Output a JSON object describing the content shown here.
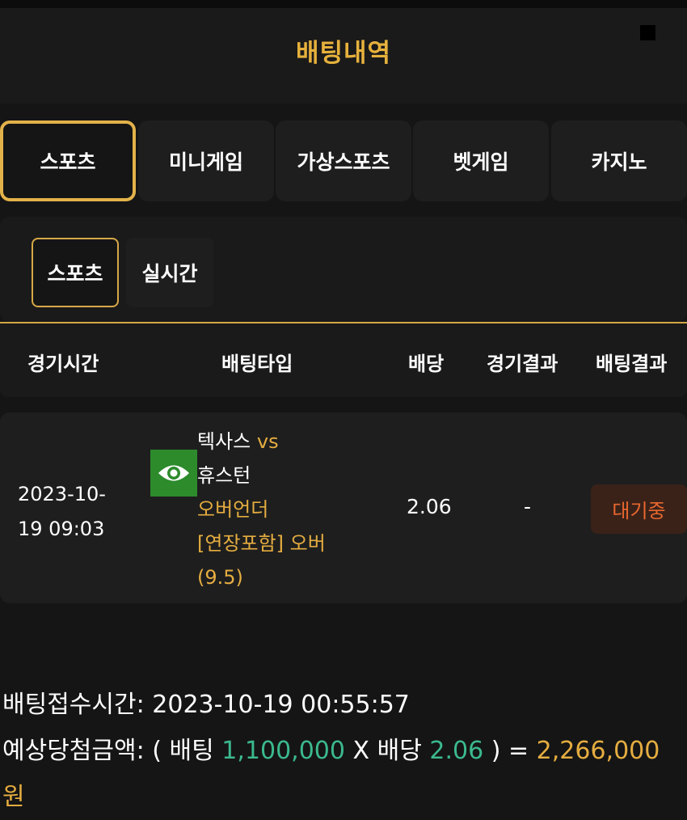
{
  "header": {
    "title": "배팅내역"
  },
  "tabs": [
    {
      "label": "스포츠",
      "active": true
    },
    {
      "label": "미니게임",
      "active": false
    },
    {
      "label": "가상스포츠",
      "active": false
    },
    {
      "label": "벳게임",
      "active": false
    },
    {
      "label": "카지노",
      "active": false
    }
  ],
  "subtabs": [
    {
      "label": "스포츠",
      "active": true
    },
    {
      "label": "실시간",
      "active": false
    }
  ],
  "table": {
    "headers": [
      "경기시간",
      "배팅타입",
      "배당",
      "경기결과",
      "배팅결과"
    ],
    "rows": [
      {
        "time_line1": "2023-10-",
        "time_line2": "19 09:03",
        "home": "텍사스",
        "vs": "vs",
        "away": "휴스턴",
        "market": "오버언더",
        "pick_line1": "[연장포함] 오버",
        "pick_line2": "(9.5)",
        "odds": "2.06",
        "result": "-",
        "status": "대기중",
        "icon": "eye-icon"
      }
    ]
  },
  "footer": {
    "accept_label": "배팅접수시간:",
    "accept_time": "2023-10-19 00:55:57",
    "expected_label": "예상당첨금액:",
    "open_paren": "(",
    "bet_label": "배팅",
    "bet_amount": "1,100,000",
    "times": "X",
    "odds_label": "배당",
    "odds_value": "2.06",
    "close_eq": ") =",
    "payout": "2,266,000",
    "currency": "원"
  },
  "colors": {
    "accent_gold": "#e5ad40",
    "amount_green": "#3bb98d",
    "status_orange": "#e9672e",
    "eye_green": "#2d8b2c"
  }
}
